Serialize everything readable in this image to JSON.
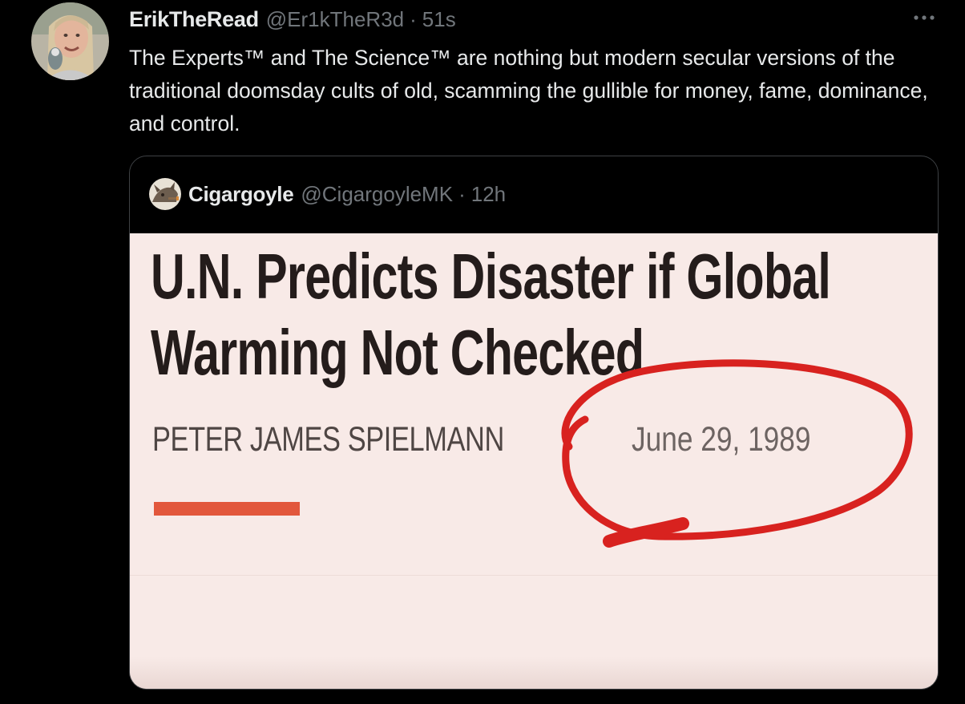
{
  "tweet": {
    "author": {
      "display_name": "ErikTheRead",
      "handle": "@Er1kTheR3d",
      "avatar_icon": "user-avatar-icon"
    },
    "separator": "·",
    "time": "51s",
    "more_icon": "more-dots-icon",
    "text": "The Experts™ and The Science™ are nothing but modern secular versions of the traditional doomsday cults of old, scamming the gullible for money, fame, dominance, and control."
  },
  "quote": {
    "author": {
      "display_name": "Cigargoyle",
      "handle": "@CigargoyleMK",
      "avatar_icon": "gargoyle-avatar-icon"
    },
    "separator": "·",
    "time": "12h",
    "image": {
      "headline_line1": "U.N. Predicts Disaster if Global",
      "headline_line2": "Warming Not Checked",
      "byline": "PETER JAMES SPIELMANN",
      "date": "June 29, 1989",
      "circle_color": "#d8221f",
      "accent_color": "#e2573c",
      "background_color": "#f8eae7"
    }
  },
  "colors": {
    "background": "#000000",
    "primary_text": "#e7e9ea",
    "secondary_text": "#71767b",
    "border": "#3e4144"
  }
}
